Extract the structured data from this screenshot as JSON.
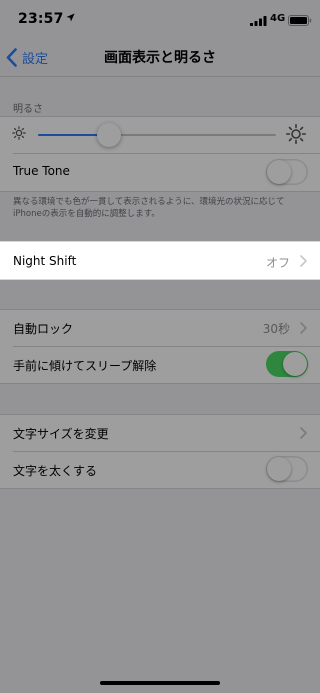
{
  "status_bar": {
    "time": "23:57",
    "network": "4G",
    "location_icon": "location-arrow-icon",
    "signal_icon": "signal-bars-icon",
    "battery_icon": "battery-icon"
  },
  "nav": {
    "back_label": "設定",
    "title": "画面表示と明るさ"
  },
  "brightness": {
    "section_header": "明るさ",
    "level": 0.3,
    "low_icon": "sun-small-icon",
    "high_icon": "sun-large-icon",
    "true_tone_label": "True Tone",
    "true_tone_on": false,
    "footnote": "異なる環境でも色が一貫して表示されるように、環境光の状況に応じてiPhoneの表示を自動的に調整します。"
  },
  "night_shift": {
    "label": "Night Shift",
    "value": "オフ"
  },
  "lock": {
    "auto_lock_label": "自動ロック",
    "auto_lock_value": "30秒",
    "raise_to_wake_label": "手前に傾けてスリープ解除",
    "raise_to_wake_on": true
  },
  "text": {
    "text_size_label": "文字サイズを変更",
    "bold_text_label": "文字を太くする",
    "bold_text_on": false
  },
  "colors": {
    "accent": "#2f7cf6",
    "toggle_on": "#4cd964",
    "background": "#efeff4"
  }
}
